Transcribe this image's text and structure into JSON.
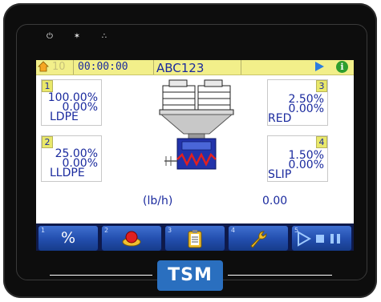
{
  "device": {
    "top_icons": [
      "power-icon",
      "brightness-icon",
      "network-icon"
    ],
    "top_glyphs": [
      "⏻",
      "✶",
      "∴"
    ],
    "brand": "TSM"
  },
  "status": {
    "counter": "10",
    "time": "00:00:00",
    "recipe": "ABC123",
    "info_glyph": "i"
  },
  "components": [
    {
      "num": "1",
      "percent": "100.00%",
      "actual": "0.00%",
      "material": "LDPE"
    },
    {
      "num": "2",
      "percent": "25.00%",
      "actual": "0.00%",
      "material": "LLDPE"
    },
    {
      "num": "3",
      "percent": "2.50%",
      "actual": "0.00%",
      "material": "RED"
    },
    {
      "num": "4",
      "percent": "1.50%",
      "actual": "0.00%",
      "material": "SLIP"
    }
  ],
  "throughput": {
    "unit_label": "(lb/h)",
    "value": "0.00"
  },
  "toolbar": [
    {
      "key": "1",
      "label": "%",
      "icon": "percent-icon"
    },
    {
      "key": "2",
      "label": "",
      "icon": "alarm-icon"
    },
    {
      "key": "3",
      "label": "",
      "icon": "clipboard-icon"
    },
    {
      "key": "4",
      "label": "",
      "icon": "wrench-icon"
    },
    {
      "key": "5",
      "label": "",
      "icon": "play-stop-pause-icon"
    }
  ],
  "colors": {
    "accent": "#1a2a9e",
    "status_bar": "#f2ef8a",
    "toolbar": "#2450b0",
    "brand": "#2a6fbf"
  }
}
